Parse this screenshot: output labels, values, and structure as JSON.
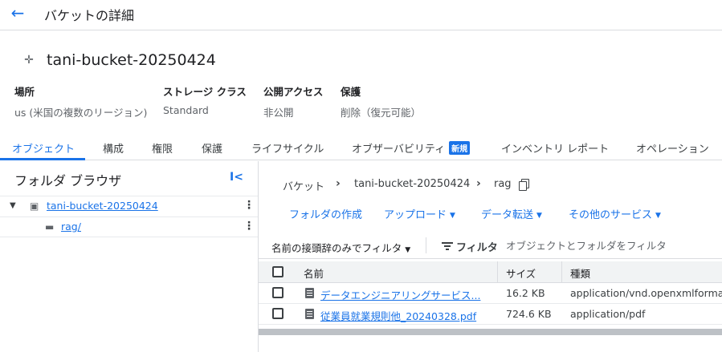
{
  "header": {
    "title": "バケットの詳細",
    "back_icon": "arrow-back-icon"
  },
  "bucket": {
    "name": "tani-bucket-20250424",
    "pin_icon": "push-pin-icon"
  },
  "properties": [
    {
      "label": "場所",
      "value": "us (米国の複数のリージョン)"
    },
    {
      "label": "ストレージ クラス",
      "value": "Standard"
    },
    {
      "label": "公開アクセス",
      "value": "非公開"
    },
    {
      "label": "保護",
      "value": "削除（復元可能）"
    }
  ],
  "tabs": [
    {
      "label": "オブジェクト",
      "active": true
    },
    {
      "label": "構成"
    },
    {
      "label": "権限"
    },
    {
      "label": "保護"
    },
    {
      "label": "ライフサイクル"
    },
    {
      "label": "オブザーバビリティ",
      "badge": "新規"
    },
    {
      "label": "インベントリ レポート"
    },
    {
      "label": "オペレーション"
    }
  ],
  "folder_browser": {
    "title": "フォルダ ブラウザ",
    "collapse_label": "I<",
    "tree": [
      {
        "label": "tani-bucket-20250424",
        "icon": "bucket-icon"
      },
      {
        "label": "rag/",
        "icon": "folder-icon"
      }
    ]
  },
  "breadcrumb": {
    "root": "バケット",
    "bucket": "tani-bucket-20250424",
    "folder": "rag"
  },
  "actions": [
    "フォルダの作成",
    "アップロード",
    "データ転送",
    "その他のサービス"
  ],
  "filter": {
    "prefix_label": "名前の接頭辞のみでフィルタ",
    "filter_label": "フィルタ",
    "placeholder": "オブジェクトとフォルダをフィルタ"
  },
  "table": {
    "columns": [
      "名前",
      "サイズ",
      "種類"
    ],
    "rows": [
      {
        "name": "データエンジニアリングサービス...",
        "size": "16.2 KB",
        "type": "application/vnd.openxmlformats-c"
      },
      {
        "name": "従業員就業規則他_20240328.pdf",
        "size": "724.6 KB",
        "type": "application/pdf"
      }
    ]
  },
  "colors": {
    "accent": "#1a73e8",
    "text": "#202124",
    "muted": "#5f6368",
    "border": "#dadce0"
  }
}
